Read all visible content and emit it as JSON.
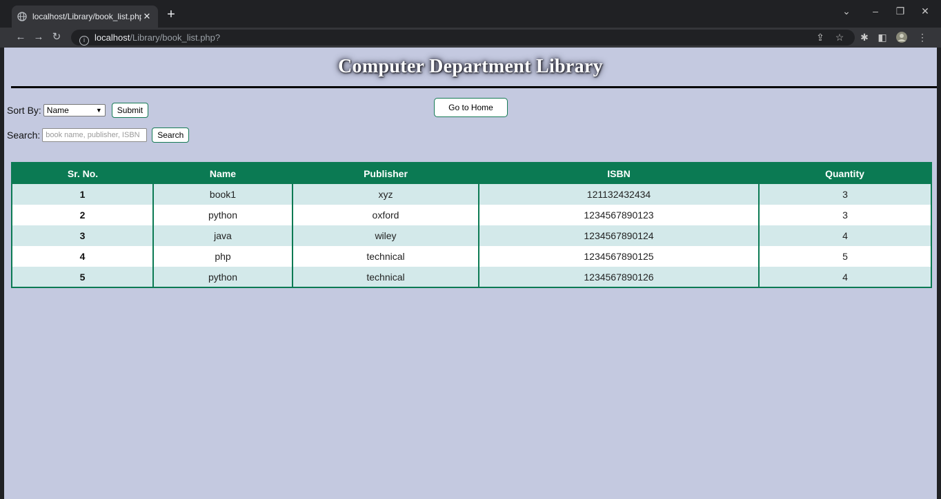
{
  "browser": {
    "tab_title": "localhost/Library/book_list.php?",
    "new_tab": "+",
    "url_host": "localhost",
    "url_path": "/Library/book_list.php?",
    "icons": [
      "globe-icon",
      "close-icon",
      "back-icon",
      "forward-icon",
      "reload-icon",
      "info-icon",
      "share-icon",
      "star-icon",
      "extensions-icon",
      "sidepanel-icon",
      "profile-icon",
      "menu-icon"
    ]
  },
  "page": {
    "title": "Computer Department Library",
    "sort_label": "Sort By:",
    "sort_value": "Name",
    "submit_label": "Submit",
    "home_label": "Go to Home",
    "search_label": "Search:",
    "search_placeholder": "book name, publisher, ISBN",
    "search_button": "Search"
  },
  "table": {
    "headers": [
      "Sr. No.",
      "Name",
      "Publisher",
      "ISBN",
      "Quantity"
    ],
    "rows": [
      [
        "1",
        "book1",
        "xyz",
        "121132432434",
        "3"
      ],
      [
        "2",
        "python",
        "oxford",
        "1234567890123",
        "3"
      ],
      [
        "3",
        "java",
        "wiley",
        "1234567890124",
        "4"
      ],
      [
        "4",
        "php",
        "technical",
        "1234567890125",
        "5"
      ],
      [
        "5",
        "python",
        "technical",
        "1234567890126",
        "4"
      ]
    ]
  },
  "colors": {
    "page_bg": "#c4c9e0",
    "table_header": "#0b7a53",
    "row_alt": "#d3e9ea"
  }
}
